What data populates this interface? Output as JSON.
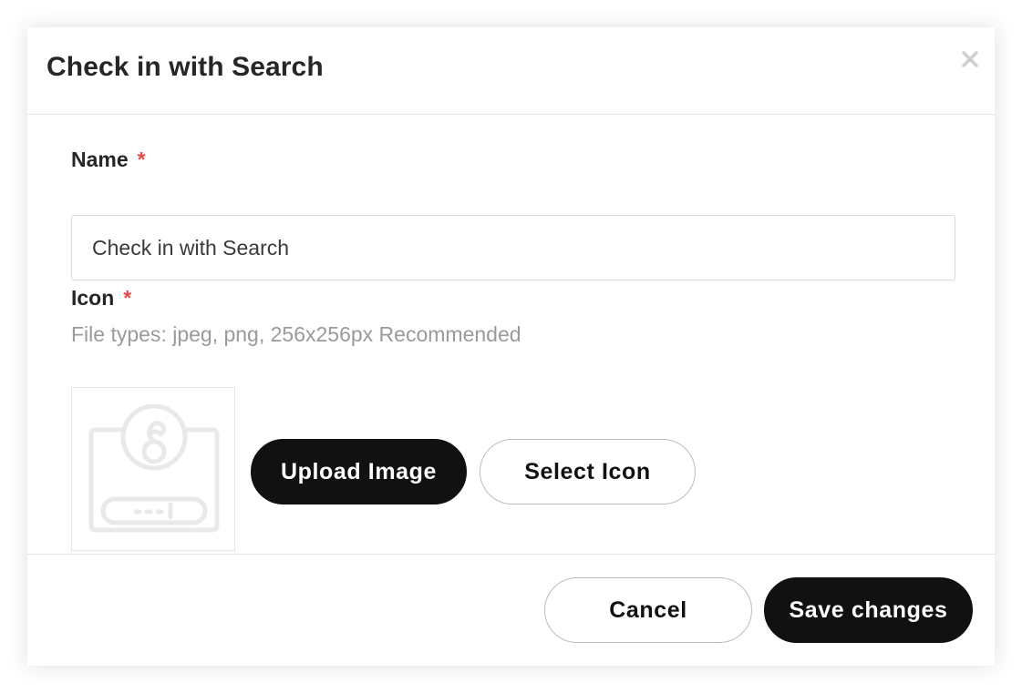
{
  "modal": {
    "title": "Check in with Search"
  },
  "form": {
    "name": {
      "label": "Name",
      "required_marker": "*",
      "value": "Check in with Search"
    },
    "icon": {
      "label": "Icon",
      "required_marker": "*",
      "help_text": "File types: jpeg, png, 256x256px Recommended",
      "preview_icon": "check-in-placeholder-icon"
    },
    "upload_label": "Upload Image",
    "select_icon_label": "Select Icon"
  },
  "footer": {
    "cancel_label": "Cancel",
    "save_label": "Save changes"
  },
  "colors": {
    "primary_button": "#111111",
    "required_star": "#e5484d",
    "help_text": "#9a9a9a"
  }
}
